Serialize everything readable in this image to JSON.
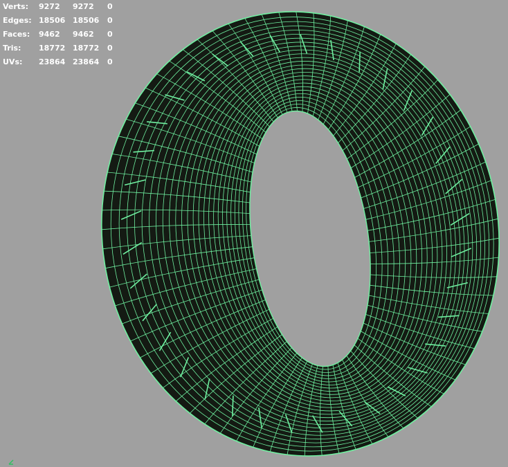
{
  "viewport": {
    "background_color": "#a0a0a0",
    "wire_color": "#6ff0a0",
    "shade_color": "#141a13",
    "object": "tire mesh (wireframe on shaded)"
  },
  "poly_count": {
    "rows": [
      {
        "label": "Verts:",
        "total": "9272",
        "selected": "9272",
        "extra": "0"
      },
      {
        "label": "Edges:",
        "total": "18506",
        "selected": "18506",
        "extra": "0"
      },
      {
        "label": "Faces:",
        "total": "9462",
        "selected": "9462",
        "extra": "0"
      },
      {
        "label": "Tris:",
        "total": "18772",
        "selected": "18772",
        "extra": "0"
      },
      {
        "label": "UVs:",
        "total": "23864",
        "selected": "23864",
        "extra": "0"
      }
    ]
  },
  "icons": {
    "axis": "axis-gizmo-icon"
  }
}
